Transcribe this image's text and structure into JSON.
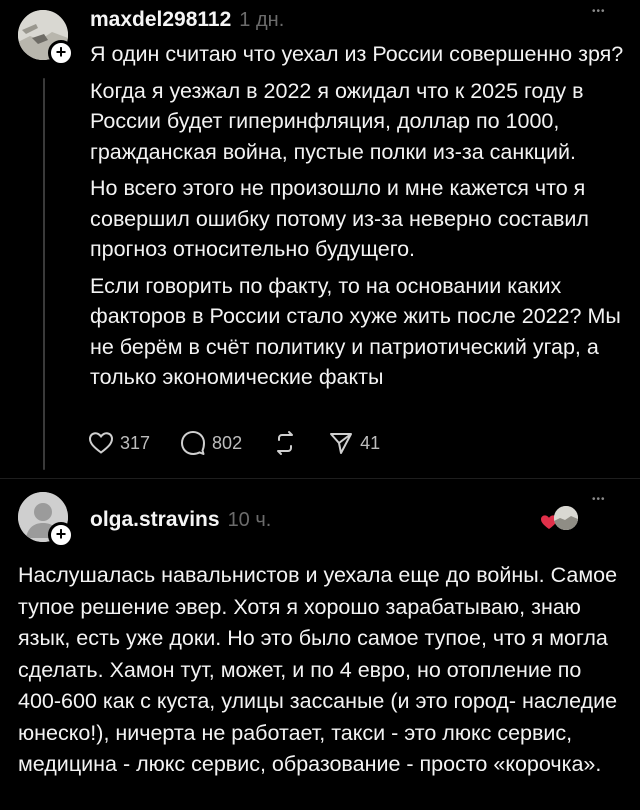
{
  "post1": {
    "username": "maxdel298112",
    "time": "1 дн.",
    "more": "•••",
    "paragraphs": [
      "Я один считаю что уехал из России совершенно зря?",
      "Когда я уезжал в 2022 я ожидал что к 2025 году в России будет гиперинфляция, доллар по 1000, гражданская война, пустые полки из-за санкций.",
      "Но всего этого не произошло и мне кажется что я совершил ошибку потому из-за неверно составил прогноз относительно будущего.",
      "Если говорить по факту, то на основании каких факторов в России стало хуже жить после 2022? Мы не берём  в счёт политику и патриотический угар, а  только экономические факты"
    ],
    "likes": "317",
    "comments": "802",
    "shares": "41",
    "icons": [
      "heart-icon",
      "comment-icon",
      "repost-icon",
      "share-icon"
    ]
  },
  "post2": {
    "username": "olga.stravins",
    "time": "10 ч.",
    "more": "•••",
    "text": "Наслушалась навальнистов и уехала еще до войны. Самое тупое решение эвер. Хотя я хорошо зарабатываю, знаю язык, есть уже доки. Но это было самое тупое, что я могла сделать. Хамон тут, может, и по 4 евро, но отопление по 400-600 как с куста, улицы зассаные (и это город- наследие юнеско!), ничерта не работает, такси - это люкс сервис, медицина - люкс сервис, образование - просто «корочка».",
    "liked_by_author_color": "#e0304a"
  },
  "colors": {
    "background": "#000000",
    "text": "#f3f3f3",
    "muted": "#6b6b6b",
    "divider": "#2a2a2a"
  }
}
